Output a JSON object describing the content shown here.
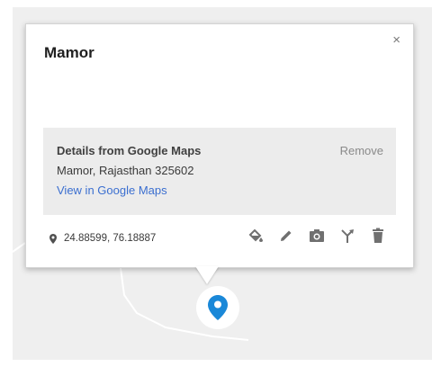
{
  "popup": {
    "title": "Mamor",
    "close_label": "×",
    "details": {
      "title": "Details from Google Maps",
      "remove_label": "Remove",
      "address": "Mamor, Rajasthan 325602",
      "view_link": "View in Google Maps"
    },
    "coordinates": "24.88599, 76.18887",
    "actions": [
      "paint-bucket-icon",
      "pencil-icon",
      "camera-icon",
      "directions-icon",
      "trash-icon"
    ]
  },
  "colors": {
    "map_bg": "#efefef",
    "link": "#3b6fd0",
    "marker": "#1a88d8",
    "icon_gray": "#707070"
  }
}
